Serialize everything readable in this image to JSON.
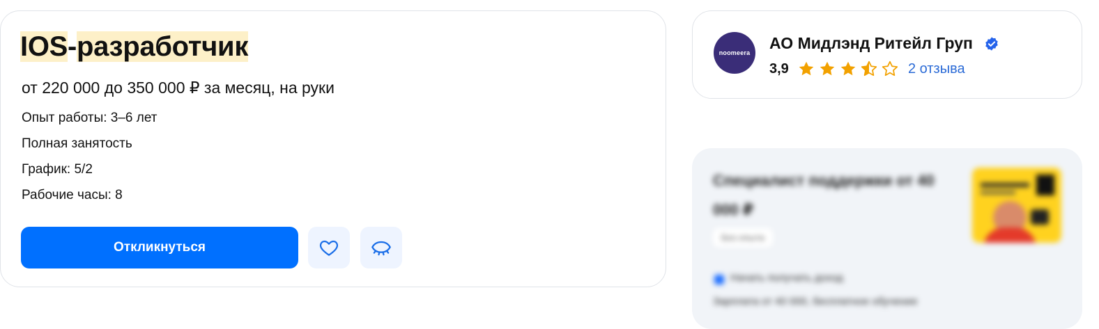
{
  "vacancy": {
    "title_part1": "IOS",
    "title_separator": "-",
    "title_part2": "разработчик",
    "salary": "от 220 000 до 350 000 ₽ за месяц, на руки",
    "experience": "Опыт работы: 3–6 лет",
    "employment": "Полная занятость",
    "schedule": "График: 5/2",
    "hours": "Рабочие часы: 8",
    "respond_label": "Откликнуться",
    "favorite_icon": "heart-icon",
    "hide_icon": "eye-closed-icon"
  },
  "company": {
    "logo_text": "noomeera",
    "name": "АО Мидлэнд Ритейл Груп",
    "verified_icon": "verified-check-icon",
    "rating": "3,9",
    "rating_stars": 3.5,
    "rating_max": 5,
    "reviews": "2 отзыва"
  },
  "ad": {
    "title": "Специалист поддержки от 40 000 ₽",
    "pill": "Без опыта",
    "line1": "Начать получать доход",
    "line2": "Зарплата от 40 000, бесплатное обучение"
  },
  "colors": {
    "accent": "#0070ff",
    "highlight": "#fdf0c8",
    "star": "#f2a100",
    "link": "#2a6ad6",
    "verified": "#2563eb",
    "logo_bg": "#3a2d78"
  }
}
